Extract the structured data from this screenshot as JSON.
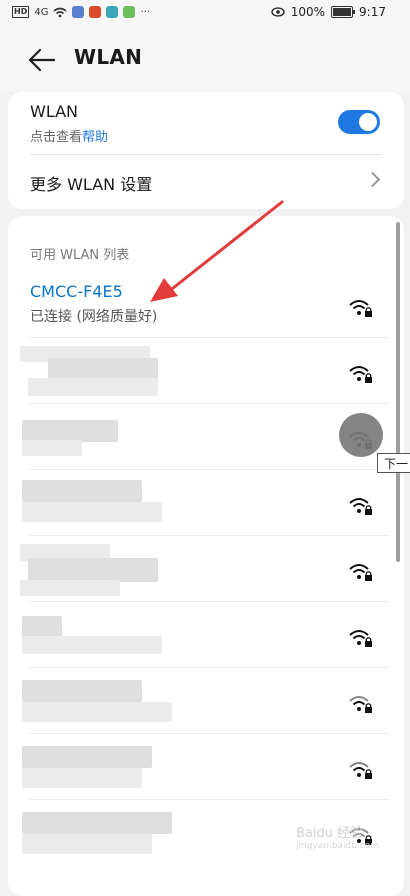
{
  "status_bar": {
    "left_hd": "HD",
    "left_sig": "4G",
    "more": "···",
    "battery_pct": "100%",
    "battery_level": 1.0,
    "time": "9:17"
  },
  "header": {
    "title": "WLAN"
  },
  "wlan_toggle": {
    "label": "WLAN",
    "subtitle_prefix": "点击查看",
    "subtitle_link": "帮助",
    "enabled": true
  },
  "more_settings": {
    "label": "更多 WLAN 设置"
  },
  "network_list": {
    "title": "可用 WLAN 列表",
    "connected": {
      "name": "CMCC-F4E5",
      "status": "已连接 (网络质量好)"
    }
  },
  "tooltip": {
    "text": "下一"
  },
  "watermark": {
    "text": "Baidu 经验",
    "sub": "jingyan.baidu.com"
  },
  "colors": {
    "accent": "#1f79e0",
    "connected_name": "#0a74c9",
    "arrow": "#e33b3b"
  }
}
